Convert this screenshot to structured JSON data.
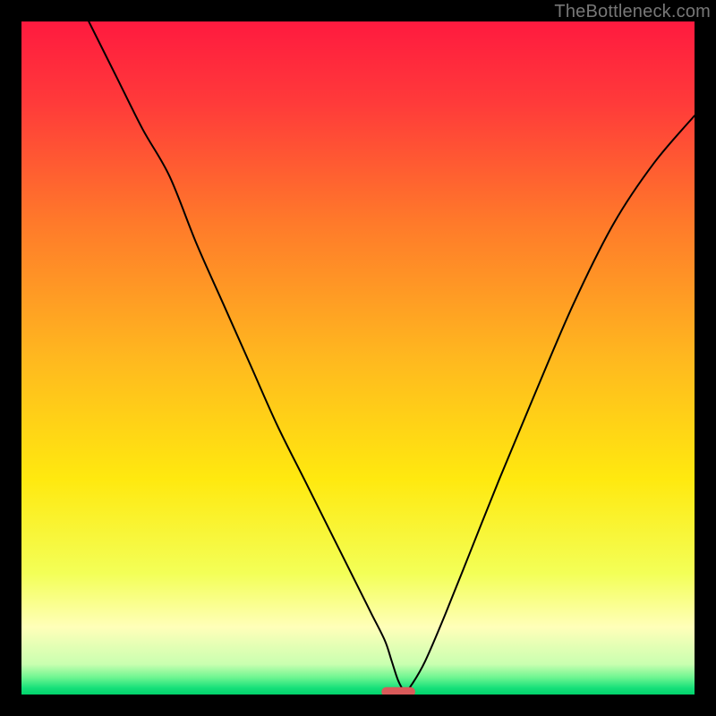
{
  "attribution": "TheBottleneck.com",
  "chart_data": {
    "type": "line",
    "title": "",
    "xlabel": "",
    "ylabel": "",
    "xlim": [
      0,
      100
    ],
    "ylim": [
      0,
      100
    ],
    "background_gradient": {
      "stops": [
        {
          "offset": 0.0,
          "color": "#ff1a3f"
        },
        {
          "offset": 0.12,
          "color": "#ff3a3a"
        },
        {
          "offset": 0.3,
          "color": "#ff7a2a"
        },
        {
          "offset": 0.5,
          "color": "#ffb81f"
        },
        {
          "offset": 0.68,
          "color": "#ffe90f"
        },
        {
          "offset": 0.82,
          "color": "#f3ff57"
        },
        {
          "offset": 0.9,
          "color": "#ffffb9"
        },
        {
          "offset": 0.955,
          "color": "#c9ffb0"
        },
        {
          "offset": 0.975,
          "color": "#6cf590"
        },
        {
          "offset": 0.99,
          "color": "#18e07a"
        },
        {
          "offset": 1.0,
          "color": "#00d36b"
        }
      ],
      "direction": "vertical"
    },
    "series": [
      {
        "name": "bottleneck-curve",
        "stroke": "#000000",
        "stroke_width": 2,
        "x": [
          10,
          14,
          18,
          22,
          26,
          30,
          34,
          38,
          42,
          46,
          50,
          52,
          54,
          55,
          56,
          57,
          58,
          60,
          63,
          67,
          71,
          76,
          82,
          88,
          94,
          100
        ],
        "y": [
          100,
          92,
          84,
          77,
          67,
          58,
          49,
          40,
          32,
          24,
          16,
          12,
          8,
          5,
          2,
          0.5,
          1.5,
          5,
          12,
          22,
          32,
          44,
          58,
          70,
          79,
          86
        ]
      }
    ],
    "marker": {
      "name": "optimal-marker",
      "shape": "capsule",
      "x": 56,
      "y": 0.4,
      "width_pct": 5.0,
      "height_pct": 1.4,
      "fill": "#d95a5a"
    }
  }
}
